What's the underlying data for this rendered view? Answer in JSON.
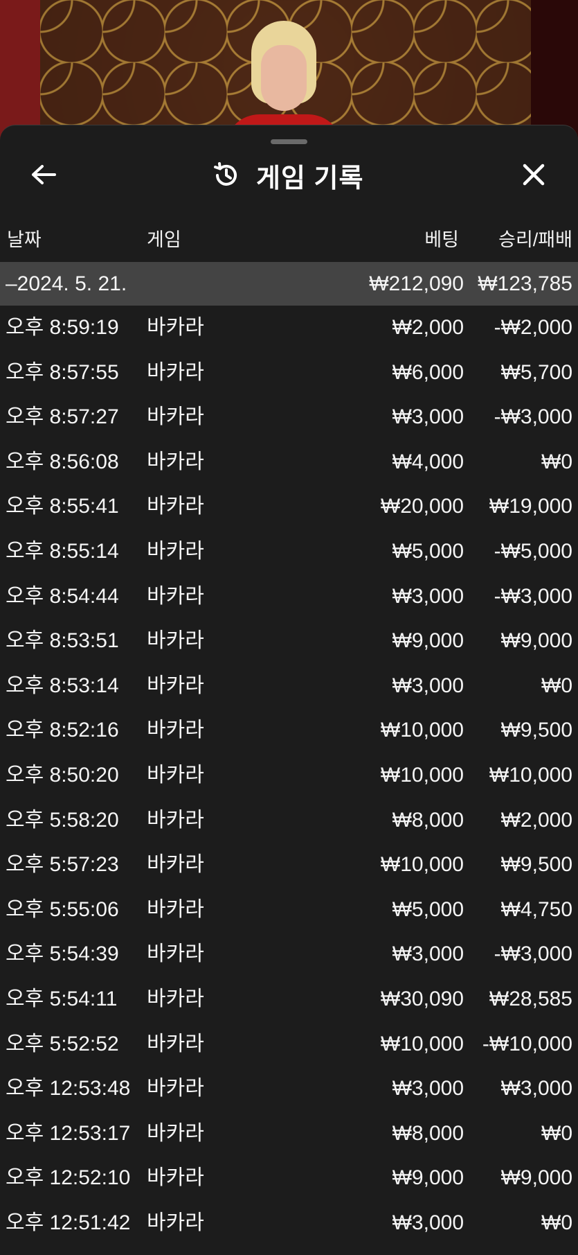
{
  "header": {
    "title": "게임 기록",
    "back_icon": "arrow-left-icon",
    "history_icon": "history-icon",
    "close_icon": "close-icon"
  },
  "columns": {
    "date": "날짜",
    "game": "게임",
    "bet": "베팅",
    "win_loss": "승리/패배"
  },
  "day_group": {
    "date": "–2024. 5. 21.",
    "bet_total": "₩212,090",
    "win_loss_total": "₩123,785"
  },
  "rows": [
    {
      "time": "오후 8:59:19",
      "game": "바카라",
      "bet": "₩2,000",
      "wl": "-₩2,000"
    },
    {
      "time": "오후 8:57:55",
      "game": "바카라",
      "bet": "₩6,000",
      "wl": "₩5,700"
    },
    {
      "time": "오후 8:57:27",
      "game": "바카라",
      "bet": "₩3,000",
      "wl": "-₩3,000"
    },
    {
      "time": "오후 8:56:08",
      "game": "바카라",
      "bet": "₩4,000",
      "wl": "₩0"
    },
    {
      "time": "오후 8:55:41",
      "game": "바카라",
      "bet": "₩20,000",
      "wl": "₩19,000"
    },
    {
      "time": "오후 8:55:14",
      "game": "바카라",
      "bet": "₩5,000",
      "wl": "-₩5,000"
    },
    {
      "time": "오후 8:54:44",
      "game": "바카라",
      "bet": "₩3,000",
      "wl": "-₩3,000"
    },
    {
      "time": "오후 8:53:51",
      "game": "바카라",
      "bet": "₩9,000",
      "wl": "₩9,000"
    },
    {
      "time": "오후 8:53:14",
      "game": "바카라",
      "bet": "₩3,000",
      "wl": "₩0"
    },
    {
      "time": "오후 8:52:16",
      "game": "바카라",
      "bet": "₩10,000",
      "wl": "₩9,500"
    },
    {
      "time": "오후 8:50:20",
      "game": "바카라",
      "bet": "₩10,000",
      "wl": "₩10,000"
    },
    {
      "time": "오후 5:58:20",
      "game": "바카라",
      "bet": "₩8,000",
      "wl": "₩2,000"
    },
    {
      "time": "오후 5:57:23",
      "game": "바카라",
      "bet": "₩10,000",
      "wl": "₩9,500"
    },
    {
      "time": "오후 5:55:06",
      "game": "바카라",
      "bet": "₩5,000",
      "wl": "₩4,750"
    },
    {
      "time": "오후 5:54:39",
      "game": "바카라",
      "bet": "₩3,000",
      "wl": "-₩3,000"
    },
    {
      "time": "오후 5:54:11",
      "game": "바카라",
      "bet": "₩30,090",
      "wl": "₩28,585"
    },
    {
      "time": "오후 5:52:52",
      "game": "바카라",
      "bet": "₩10,000",
      "wl": "-₩10,000"
    },
    {
      "time": "오후 12:53:48",
      "game": "바카라",
      "bet": "₩3,000",
      "wl": "₩3,000"
    },
    {
      "time": "오후 12:53:17",
      "game": "바카라",
      "bet": "₩8,000",
      "wl": "₩0"
    },
    {
      "time": "오후 12:52:10",
      "game": "바카라",
      "bet": "₩9,000",
      "wl": "₩9,000"
    },
    {
      "time": "오후 12:51:42",
      "game": "바카라",
      "bet": "₩3,000",
      "wl": "₩0"
    }
  ]
}
